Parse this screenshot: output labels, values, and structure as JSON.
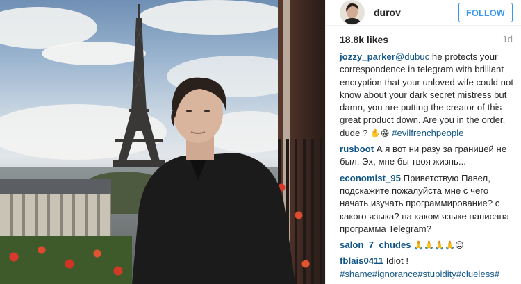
{
  "post": {
    "username": "durov",
    "follow_label": "FOLLOW",
    "likes": "18.8k likes",
    "age": "1d"
  },
  "comments": [
    {
      "author": "jozzy_parker",
      "parts": [
        {
          "type": "mention",
          "text": "@dubuc"
        },
        {
          "type": "text",
          "text": " he protects your correspondence in telegram with brilliant encryption that your unloved wife could not know about your dark secret mistress but damn, you are putting the creator of this great product down. Are you in the order, dude ? "
        },
        {
          "type": "emoji",
          "text": "✋😁"
        },
        {
          "type": "text",
          "text": " "
        },
        {
          "type": "tag",
          "text": "#evilfrenchpeople"
        }
      ]
    },
    {
      "author": "rusboot",
      "parts": [
        {
          "type": "text",
          "text": " А я вот ни разу за границей не был. Эх, мне бы твоя жизнь..."
        }
      ]
    },
    {
      "author": "economist_95",
      "parts": [
        {
          "type": "text",
          "text": " Приветствую Павел, подскажите пожалуйста мне с чего начать изучать программирование? с какого языка? на каком языке написана программа Telegram?"
        }
      ]
    },
    {
      "author": "salon_7_chudes",
      "parts": [
        {
          "type": "text",
          "text": " "
        },
        {
          "type": "emoji",
          "text": "🙏🙏🙏🙏😒"
        }
      ]
    },
    {
      "author": "fblais0411",
      "parts": [
        {
          "type": "text",
          "text": " Idiot ! "
        },
        {
          "type": "tag",
          "text": "#shame"
        },
        {
          "type": "tag",
          "text": "#ignorance"
        },
        {
          "type": "tag",
          "text": "#stupidity"
        },
        {
          "type": "tag",
          "text": "#clueless"
        },
        {
          "type": "tag",
          "text": "#"
        }
      ]
    }
  ]
}
